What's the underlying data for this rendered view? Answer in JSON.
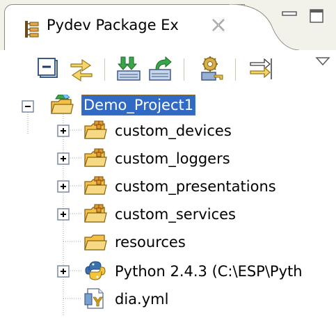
{
  "view": {
    "tab_title": "Pydev Package Ex",
    "icons": {
      "tab": "package-explorer-icon",
      "close": "close-icon",
      "minimize": "minimize-icon",
      "maximize": "maximize-icon"
    }
  },
  "toolbar": {
    "buttons": [
      {
        "name": "collapse-all-button",
        "icon": "collapse-all-icon"
      },
      {
        "name": "link-with-editor-button",
        "icon": "link-arrows-icon"
      },
      {
        "name": "import-button",
        "icon": "import-icon"
      },
      {
        "name": "export-button",
        "icon": "export-icon"
      },
      {
        "name": "configure-button",
        "icon": "gear-key-icon"
      },
      {
        "name": "filter-button",
        "icon": "filter-arrows-icon"
      },
      {
        "name": "view-menu-button",
        "icon": "chevron-down-icon"
      }
    ]
  },
  "tree": {
    "project": {
      "label": "Demo_Project1",
      "expanded": true,
      "selected": true
    },
    "children": [
      {
        "label": "custom_devices",
        "kind": "package-folder",
        "expandable": true
      },
      {
        "label": "custom_loggers",
        "kind": "package-folder",
        "expandable": true
      },
      {
        "label": "custom_presentations",
        "kind": "package-folder",
        "expandable": true
      },
      {
        "label": "custom_services",
        "kind": "package-folder",
        "expandable": true
      },
      {
        "label": "resources",
        "kind": "folder",
        "expandable": false
      },
      {
        "label": "Python 2.4.3  (C:\\ESP\\Pyth",
        "kind": "python-interpreter",
        "expandable": true
      },
      {
        "label": "dia.yml",
        "kind": "yaml-file",
        "expandable": false
      }
    ]
  },
  "colors": {
    "selection": "#316ac5",
    "folder": "#f3c04a",
    "tab_background": "#f2f1ea"
  }
}
